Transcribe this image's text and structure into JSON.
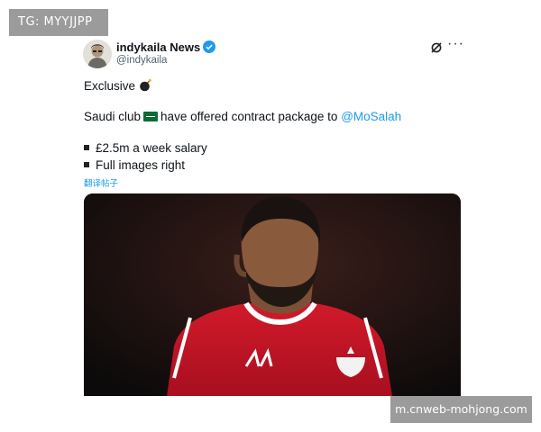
{
  "watermarks": {
    "top_left": "TG: MYYJJPP",
    "bottom_right": "m.cnweb-mohjong.com"
  },
  "tweet": {
    "author_name": "indykaila News",
    "author_handle": "@indykaila",
    "line1": "Exclusive",
    "line2_prefix": "Saudi club",
    "line2_middle": "have offered contract package to",
    "mention": "@MoSalah",
    "bullets": [
      "£2.5m a week salary",
      "Full images right"
    ],
    "translate_label": "翻译帖子"
  },
  "icons": {
    "verified": "verified-badge-icon",
    "grok": "grok-icon",
    "more": "more-options-icon",
    "bomb": "bomb-emoji-icon",
    "flag": "saudi-flag-icon"
  },
  "colors": {
    "accent": "#1d9bf0",
    "watermark_bg": "#9b9b9b",
    "jersey": "#c8102e"
  }
}
